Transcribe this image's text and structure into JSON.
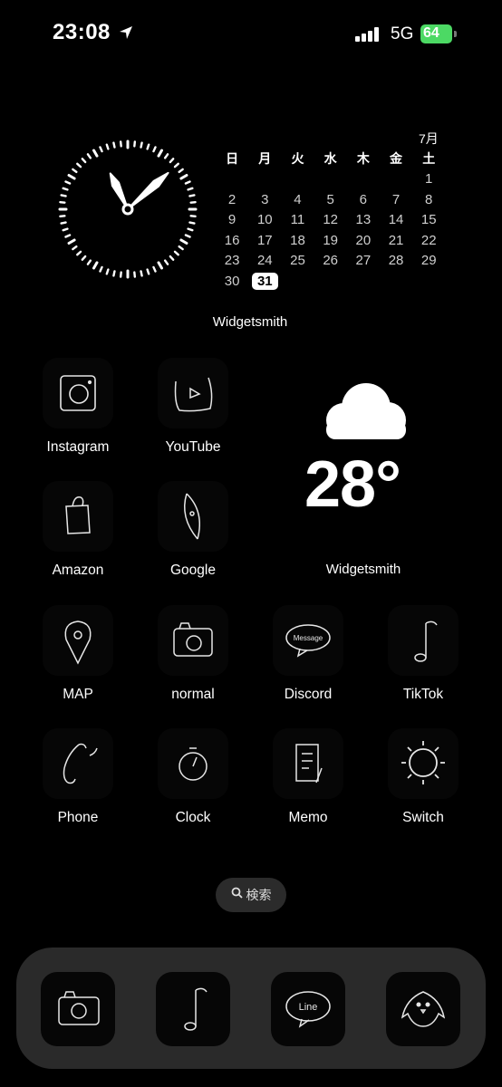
{
  "status_bar": {
    "time": "23:08",
    "network": "5G",
    "battery": "64",
    "location_icon": "location-arrow-icon",
    "signal_icon": "cellular-signal-icon"
  },
  "widget_calendar": {
    "month": "7月",
    "weekdays": [
      "日",
      "月",
      "火",
      "水",
      "木",
      "金",
      "土"
    ],
    "weeks": [
      [
        "",
        "",
        "",
        "",
        "",
        "",
        "1"
      ],
      [
        "2",
        "3",
        "4",
        "5",
        "6",
        "7",
        "8"
      ],
      [
        "9",
        "10",
        "11",
        "12",
        "13",
        "14",
        "15"
      ],
      [
        "16",
        "17",
        "18",
        "19",
        "20",
        "21",
        "22"
      ],
      [
        "23",
        "24",
        "25",
        "26",
        "27",
        "28",
        "29"
      ],
      [
        "30",
        "31",
        "",
        "",
        "",
        "",
        ""
      ]
    ],
    "today": "31",
    "label": "Widgetsmith"
  },
  "widget_weather": {
    "temperature": "28°",
    "icon": "cloud-icon",
    "label": "Widgetsmith"
  },
  "apps": [
    {
      "label": "Instagram",
      "icon": "instagram-icon"
    },
    {
      "label": "YouTube",
      "icon": "youtube-icon"
    },
    {
      "label": "Amazon",
      "icon": "shopping-bag-icon"
    },
    {
      "label": "Google",
      "icon": "google-icon"
    },
    {
      "label": "MAP",
      "icon": "map-pin-icon"
    },
    {
      "label": "normal",
      "icon": "camera-icon"
    },
    {
      "label": "Discord",
      "icon": "message-bubble-icon",
      "icon_text": "Message"
    },
    {
      "label": "TikTok",
      "icon": "music-note-icon"
    },
    {
      "label": "Phone",
      "icon": "phone-icon"
    },
    {
      "label": "Clock",
      "icon": "clock-icon"
    },
    {
      "label": "Memo",
      "icon": "memo-icon"
    },
    {
      "label": "Switch",
      "icon": "sun-icon"
    }
  ],
  "search": {
    "label": "検索",
    "icon": "search-icon"
  },
  "dock": [
    {
      "icon": "camera-icon"
    },
    {
      "icon": "music-note-icon"
    },
    {
      "icon": "line-icon",
      "icon_text": "Line"
    },
    {
      "icon": "bird-icon"
    }
  ]
}
